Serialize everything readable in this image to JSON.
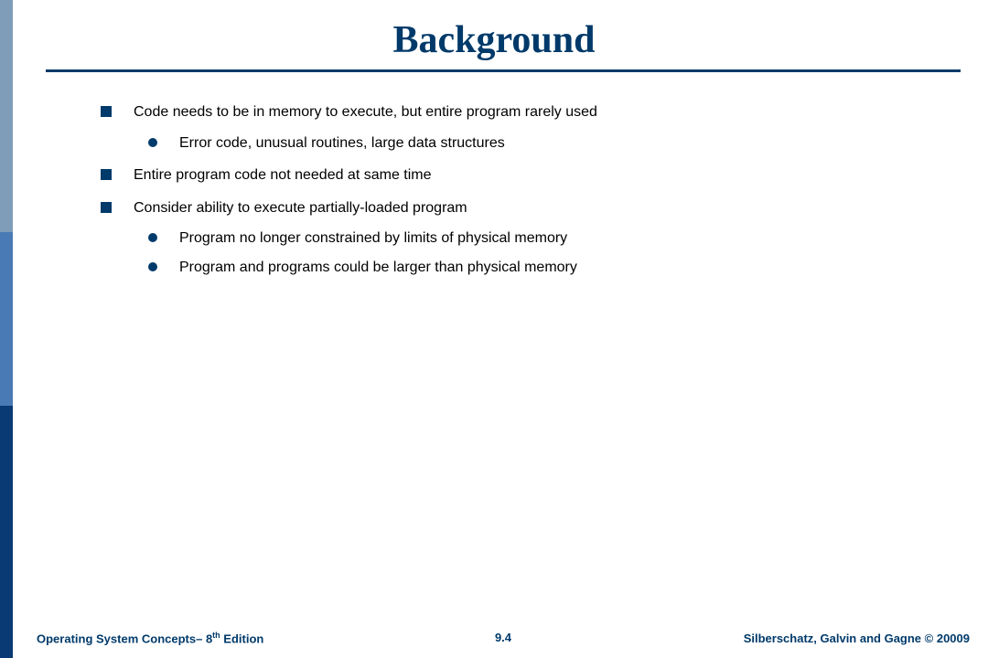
{
  "title": "Background",
  "bullets": [
    {
      "text": "Code needs to be in memory to execute, but entire program rarely used",
      "sub": [
        "Error code, unusual routines, large data structures"
      ]
    },
    {
      "text": "Entire program code not needed at same time",
      "sub": []
    },
    {
      "text": "Consider ability to execute partially-loaded program",
      "sub": [
        "Program no longer constrained by limits of physical memory",
        "Program and programs could be larger than physical memory"
      ]
    }
  ],
  "footer": {
    "left_prefix": "Operating System Concepts– 8",
    "left_sup": "th",
    "left_suffix": " Edition",
    "center": "9.4",
    "right": "Silberschatz, Galvin and Gagne © 20009"
  }
}
